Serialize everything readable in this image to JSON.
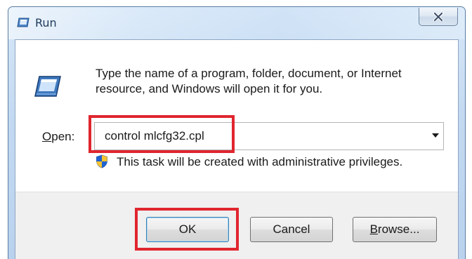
{
  "window": {
    "title": "Run",
    "title_icon": "run-icon",
    "close_glyph": "X"
  },
  "dialog": {
    "icon": "run-icon",
    "description": "Type the name of a program, folder, document, or Internet resource, and Windows will open it for you.",
    "open_label_accel": "O",
    "open_label_rest": "pen:",
    "command_value": "control mlcfg32.cpl",
    "admin_icon": "uac-shield-icon",
    "admin_note": "This task will be created with administrative privileges."
  },
  "buttons": {
    "ok_label": "OK",
    "cancel_label": "Cancel",
    "browse_accel": "B",
    "browse_rest": "rowse..."
  },
  "colors": {
    "highlight": "#e0262f",
    "frame": "#c3d9f1"
  }
}
